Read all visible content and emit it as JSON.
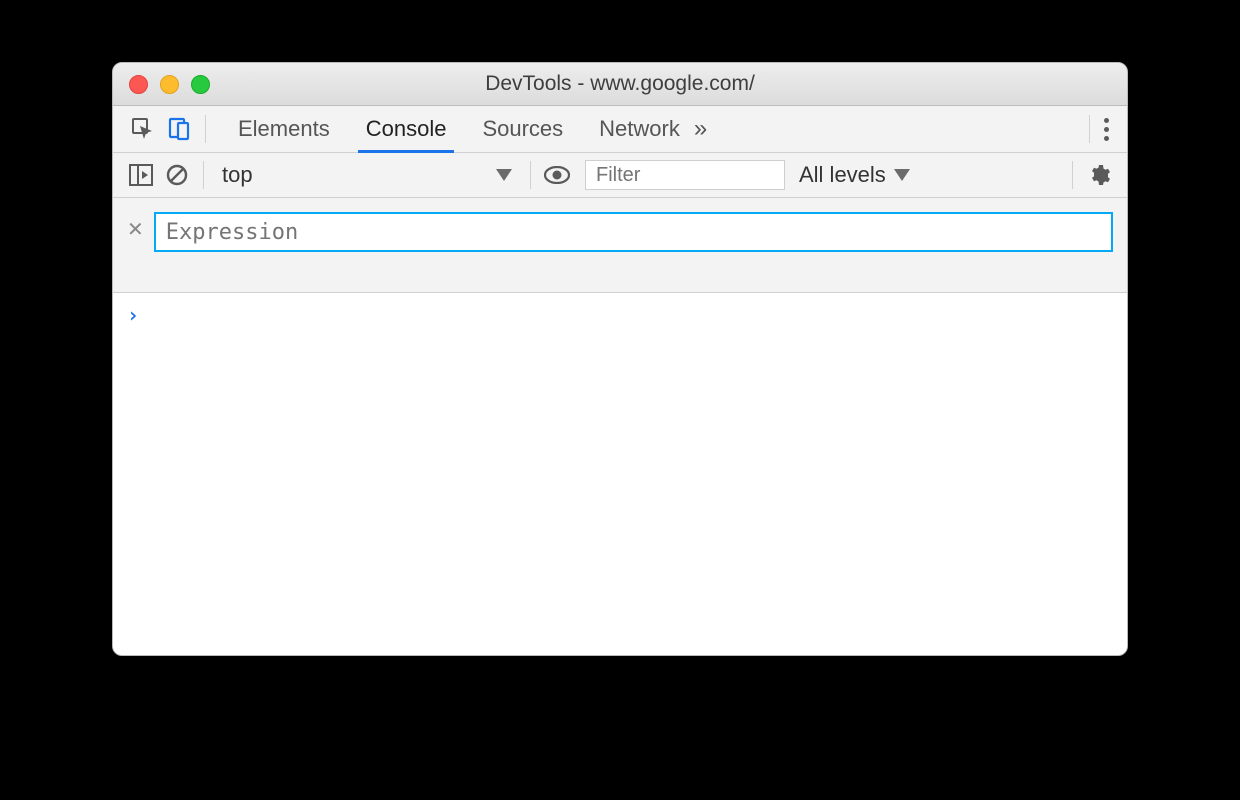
{
  "window": {
    "title": "DevTools - www.google.com/"
  },
  "tabs": {
    "items": [
      "Elements",
      "Console",
      "Sources",
      "Network"
    ],
    "active": "Console",
    "overflow_glyph": "»"
  },
  "console_toolbar": {
    "context": "top",
    "filter_placeholder": "Filter",
    "levels_label": "All levels"
  },
  "live_expression": {
    "placeholder": "Expression",
    "value": ""
  },
  "prompt_glyph": "›"
}
